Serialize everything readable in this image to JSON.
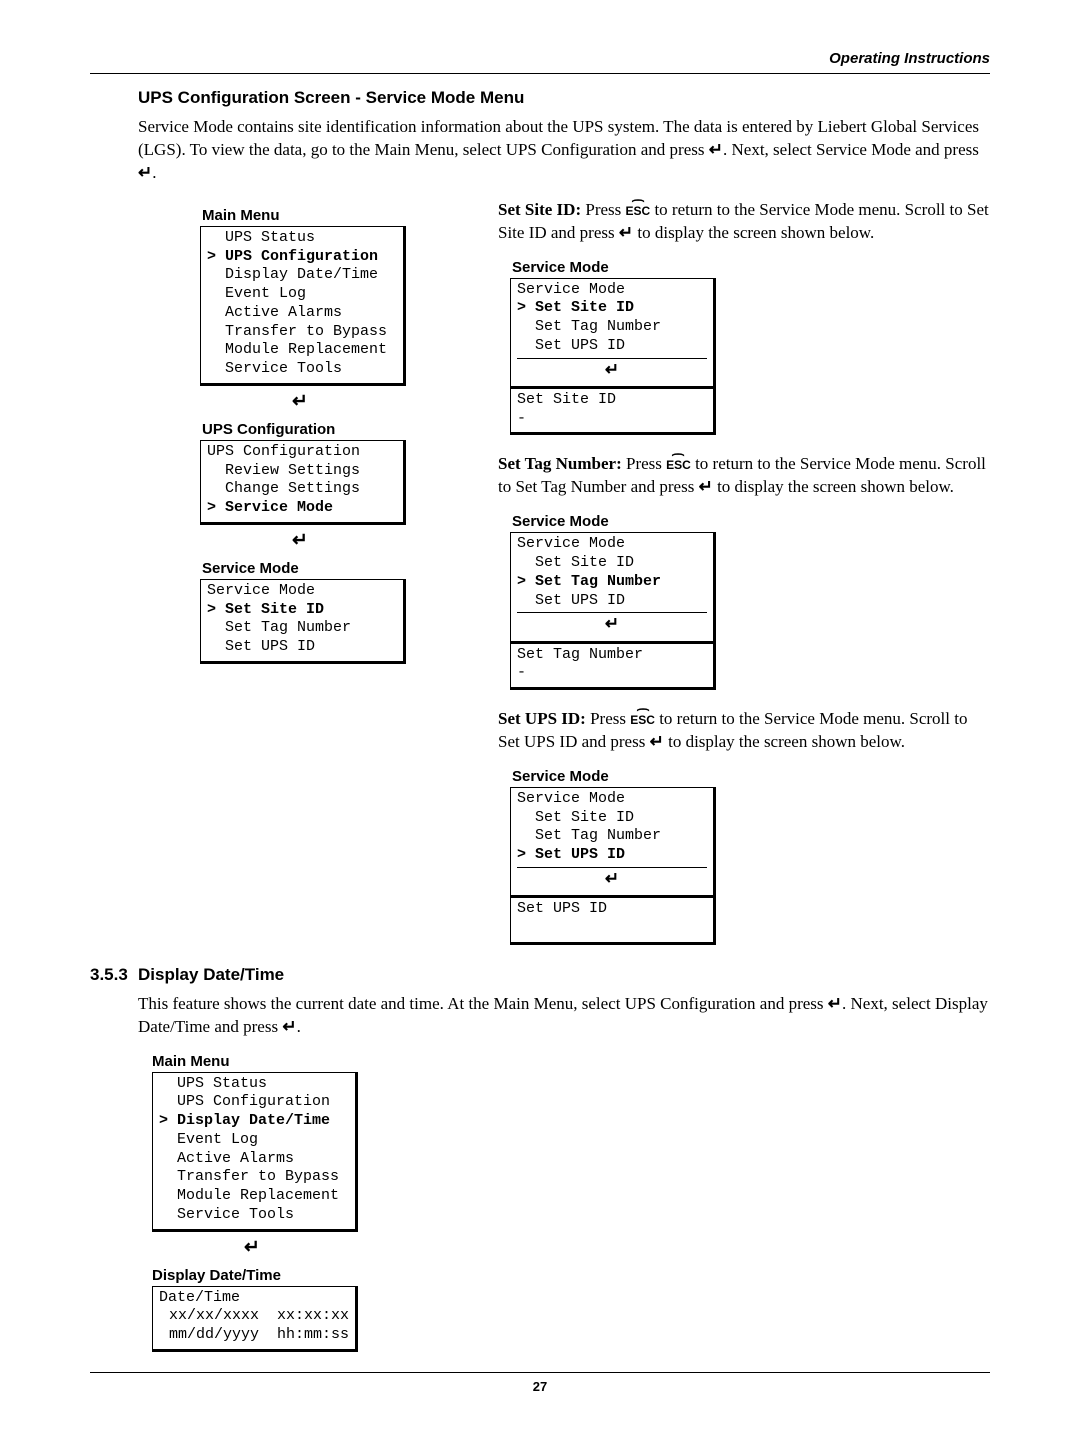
{
  "header": {
    "right": "Operating Instructions"
  },
  "section1": {
    "title": "UPS Configuration Screen - Service Mode Menu",
    "para1_a": "Service Mode contains site identification information about the UPS system. The data is entered by Liebert Global Services (LGS). To view the data, go to the Main Menu, select UPS Configuration and press ",
    "para1_b": ". Next, select Service Mode and press ",
    "para1_c": "."
  },
  "left": {
    "mainmenu_title": "Main Menu",
    "mainmenu_items": [
      {
        "txt": "UPS Status"
      },
      {
        "txt": "UPS Configuration",
        "sel": true
      },
      {
        "txt": "Display Date/Time"
      },
      {
        "txt": "Event Log"
      },
      {
        "txt": "Active Alarms"
      },
      {
        "txt": "Transfer to Bypass"
      },
      {
        "txt": "Module Replacement"
      },
      {
        "txt": "Service Tools"
      }
    ],
    "upscfg_title": "UPS Configuration",
    "upscfg_header": "UPS Configuration",
    "upscfg_items": [
      {
        "txt": "Review Settings"
      },
      {
        "txt": "Change Settings"
      },
      {
        "txt": "Service Mode",
        "sel": true
      }
    ],
    "svcmode_title": "Service Mode",
    "svc_header": "Service Mode",
    "svc_items": [
      {
        "txt": "Set Site ID",
        "sel": true
      },
      {
        "txt": "Set Tag Number"
      },
      {
        "txt": "Set UPS ID"
      }
    ]
  },
  "right": {
    "site": {
      "lead": "Set Site ID:",
      "text_a": " Press ",
      "text_b": " to return to the Service Mode menu. Scroll to Set Site ID and press ",
      "text_c": " to display the screen shown below.",
      "panel_title": "Service Mode",
      "header": "Service Mode",
      "items": [
        {
          "txt": "Set Site ID",
          "sel": true
        },
        {
          "txt": "Set Tag Number"
        },
        {
          "txt": "Set UPS ID"
        }
      ],
      "result_line": "Set Site ID",
      "result_sub": "-"
    },
    "tag": {
      "lead": "Set Tag Number:",
      "text_a": " Press ",
      "text_b": " to return to the Service Mode menu. Scroll to Set Tag Number and press ",
      "text_c": " to display the screen shown below.",
      "panel_title": "Service Mode",
      "header": "Service Mode",
      "items": [
        {
          "txt": "Set Site ID"
        },
        {
          "txt": "Set Tag Number",
          "sel": true
        },
        {
          "txt": "Set UPS ID"
        }
      ],
      "result_line": "Set Tag Number",
      "result_sub": "-"
    },
    "upsid": {
      "lead": "Set UPS ID:",
      "text_a": " Press ",
      "text_b": " to return to the Service Mode menu. Scroll to Set UPS ID and press ",
      "text_c": " to display the screen shown below.",
      "panel_title": "Service Mode",
      "header": "Service Mode",
      "items": [
        {
          "txt": "Set Site ID"
        },
        {
          "txt": "Set Tag Number"
        },
        {
          "txt": "Set UPS ID",
          "sel": true
        }
      ],
      "result_line": "Set UPS ID",
      "result_sub": " "
    }
  },
  "section2": {
    "num": "3.5.3",
    "title": "Display Date/Time",
    "para_a": "This feature shows the current date and time. At the Main Menu, select UPS Configuration and press ",
    "para_b": ". Next, select Display Date/Time and press ",
    "para_c": ".",
    "mainmenu_title": "Main Menu",
    "mainmenu_items": [
      {
        "txt": "UPS Status"
      },
      {
        "txt": "UPS Configuration"
      },
      {
        "txt": "Display Date/Time",
        "sel": true
      },
      {
        "txt": "Event Log"
      },
      {
        "txt": "Active Alarms"
      },
      {
        "txt": "Transfer to Bypass"
      },
      {
        "txt": "Module Replacement"
      },
      {
        "txt": "Service Tools"
      }
    ],
    "dt_title": "Display Date/Time",
    "dt_header": "Date/Time",
    "dt_line1": "xx/xx/xxxx  xx:xx:xx",
    "dt_line2": "mm/dd/yyyy  hh:mm:ss"
  },
  "footer": {
    "pageno": "27"
  }
}
